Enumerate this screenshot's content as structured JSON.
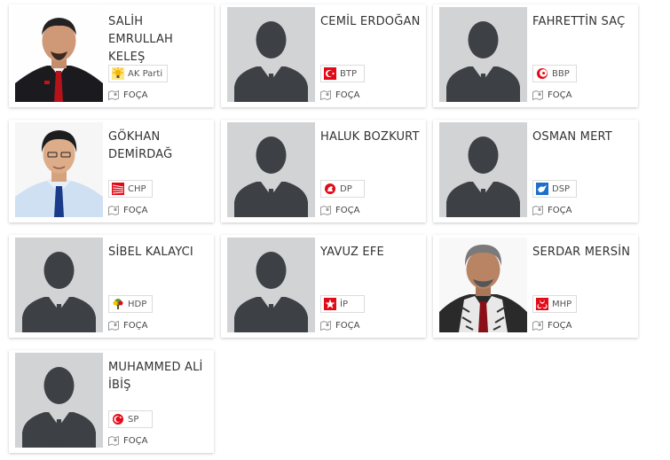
{
  "candidates": [
    {
      "name_line1": "SALİH EMRULLAH",
      "name_line2": "KELEŞ",
      "party": "AK Parti",
      "party_logo": "akp-bulb-icon",
      "location": "FOÇA",
      "photo": "real"
    },
    {
      "name_line1": "CEMİL ERDOĞAN",
      "name_line2": "",
      "party": "BTP",
      "party_logo": "btp-crescent-icon",
      "location": "FOÇA",
      "photo": "silhouette"
    },
    {
      "name_line1": "FAHRETTİN SAÇ",
      "name_line2": "",
      "party": "BBP",
      "party_logo": "bbp-crescent-icon",
      "location": "FOÇA",
      "photo": "silhouette"
    },
    {
      "name_line1": "GÖKHAN",
      "name_line2": "DEMİRDAĞ",
      "party": "CHP",
      "party_logo": "chp-arrows-icon",
      "location": "FOÇA",
      "photo": "real"
    },
    {
      "name_line1": "HALUK BOZKURT",
      "name_line2": "",
      "party": "DP",
      "party_logo": "dp-horse-icon",
      "location": "FOÇA",
      "photo": "silhouette"
    },
    {
      "name_line1": "OSMAN MERT",
      "name_line2": "",
      "party": "DSP",
      "party_logo": "dsp-dove-icon",
      "location": "FOÇA",
      "photo": "silhouette"
    },
    {
      "name_line1": "SİBEL KALAYCI",
      "name_line2": "",
      "party": "HDP",
      "party_logo": "hdp-tree-icon",
      "location": "FOÇA",
      "photo": "silhouette"
    },
    {
      "name_line1": "YAVUZ EFE",
      "name_line2": "",
      "party": "İP",
      "party_logo": "ip-sun-icon",
      "location": "FOÇA",
      "photo": "silhouette"
    },
    {
      "name_line1": "SERDAR MERSİN",
      "name_line2": "",
      "party": "MHP",
      "party_logo": "mhp-crescents-icon",
      "location": "FOÇA",
      "photo": "real"
    },
    {
      "name_line1": "MUHAMMED ALİ",
      "name_line2": "İBİŞ",
      "party": "SP",
      "party_logo": "sp-crescent-icon",
      "location": "FOÇA",
      "photo": "silhouette"
    }
  ],
  "colors": {
    "card_bg": "#ffffff",
    "photo_placeholder_bg": "#d2d3d5",
    "silhouette": "#3d4045",
    "party_red": "#e30a17",
    "dsp_blue": "#1e6fc9",
    "akp_yellow": "#f7b500",
    "hdp_green": "#5a9a2f"
  }
}
